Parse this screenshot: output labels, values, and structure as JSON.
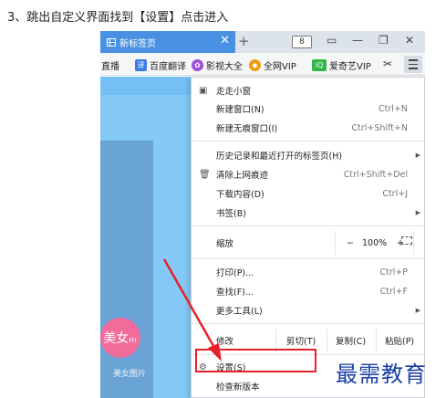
{
  "caption": "3、跳出自定义界面找到【设置】点击进入",
  "browser": {
    "tab": {
      "title": "新标签页",
      "close": "✕"
    },
    "new_tab": "+",
    "tab_count": "8",
    "window_buttons": [
      "▭",
      "—",
      "❐",
      "✕"
    ],
    "bookmarks": [
      {
        "label": "I直播",
        "icon": "",
        "color": ""
      },
      {
        "label": "百度翻译",
        "icon": "译",
        "color": "#3d7be5"
      },
      {
        "label": "影视大全",
        "icon": "✿",
        "color": "#9b4fd9"
      },
      {
        "label": "全网VIP",
        "icon": "◆",
        "color": "#f39c12"
      },
      {
        "label": "爱奇艺VIP",
        "icon": "iQ",
        "color": "#35b54a"
      }
    ],
    "scissors": "✂"
  },
  "page": {
    "beauty_text": "美女ₘ",
    "beauty_label": "美女图片"
  },
  "menu": {
    "items": [
      {
        "label": "走走小窗",
        "shortcut": "",
        "icon": "▣"
      },
      {
        "label": "新建窗口(N)",
        "shortcut": "Ctrl+N"
      },
      {
        "label": "新建无痕窗口(I)",
        "shortcut": "Ctrl+Shift+N"
      },
      {
        "label": "历史记录和最近打开的标签页(H)",
        "arrow": "▶"
      },
      {
        "label": "清除上网痕迹",
        "shortcut": "Ctrl+Shift+Del",
        "icon": "🗑"
      },
      {
        "label": "下载内容(D)",
        "shortcut": "Ctrl+J"
      },
      {
        "label": "书签(B)",
        "arrow": "▶"
      },
      {
        "label": "打印(P)...",
        "shortcut": "Ctrl+P"
      },
      {
        "label": "查找(F)...",
        "shortcut": "Ctrl+F"
      },
      {
        "label": "更多工具(L)",
        "arrow": "▶"
      },
      {
        "label": "设置(S)",
        "icon": "⚙"
      },
      {
        "label": "检查新版本"
      }
    ],
    "zoom": {
      "label": "缩放",
      "minus": "−",
      "value": "100%",
      "plus": "+"
    },
    "edit": {
      "label": "修改",
      "cut": "剪切(T)",
      "copy": "复制(C)",
      "paste": "粘贴(P)"
    }
  },
  "watermark": "最需教育",
  "colors": {
    "highlight_box": "#e8202a",
    "arrow": "#e8202a",
    "tab": "#4a90e2",
    "watermark": "#1a3fa8"
  }
}
